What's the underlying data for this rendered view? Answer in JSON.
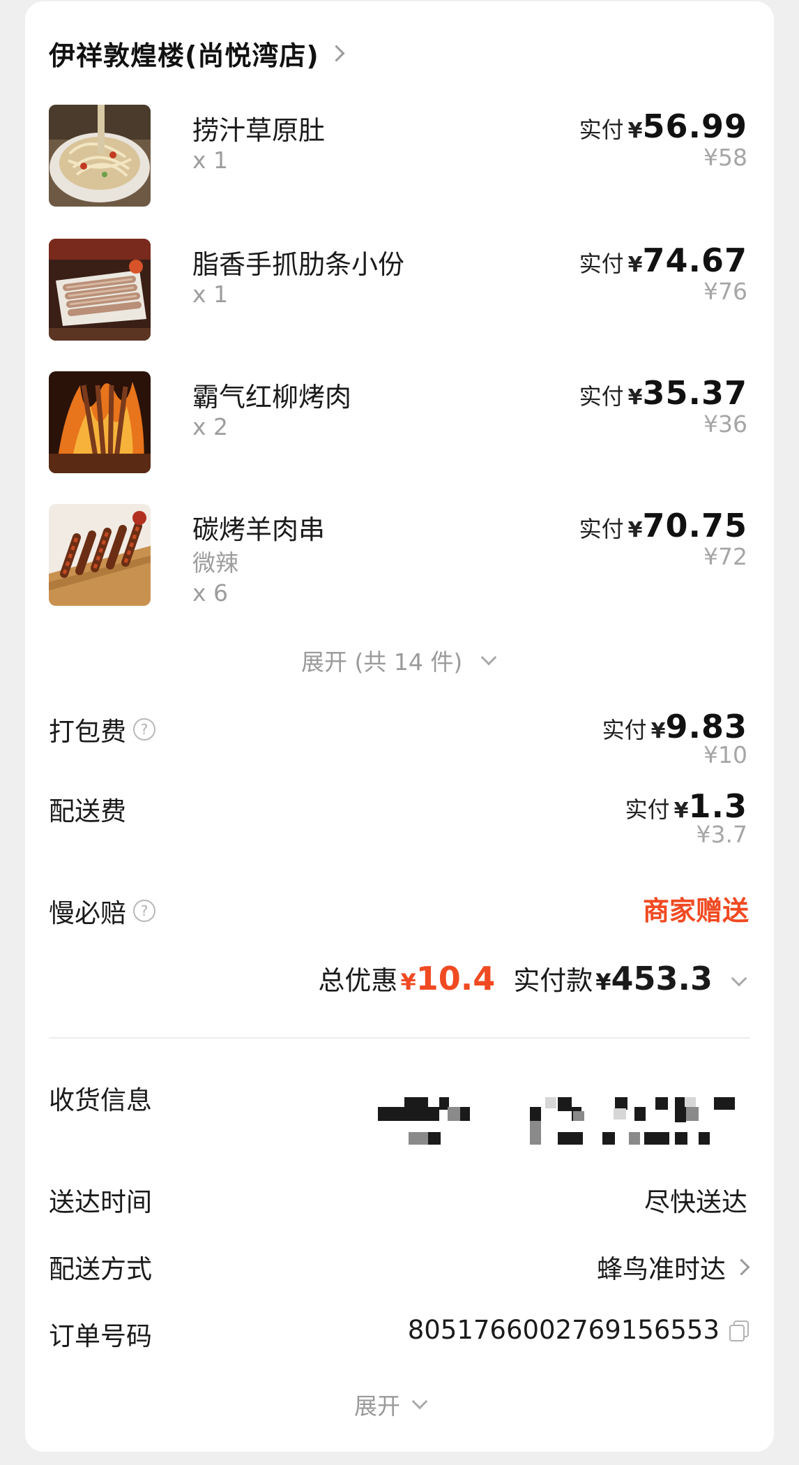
{
  "shop": {
    "name": "伊祥敦煌楼(尚悦湾店)"
  },
  "items": [
    {
      "name": "捞汁草原肚",
      "spec": "",
      "qty": "x 1",
      "paid_label": "实付",
      "currency": "¥",
      "paid": "56.99",
      "original": "¥58",
      "image": "noodle-salad-dish"
    },
    {
      "name": "脂香手抓肋条小份",
      "spec": "",
      "qty": "x 1",
      "paid_label": "实付",
      "currency": "¥",
      "paid": "74.67",
      "original": "¥76",
      "image": "sliced-lamb-platter"
    },
    {
      "name": "霸气红柳烤肉",
      "spec": "",
      "qty": "x 2",
      "paid_label": "实付",
      "currency": "¥",
      "paid": "35.37",
      "original": "¥36",
      "image": "flaming-skewers"
    },
    {
      "name": "碳烤羊肉串",
      "spec": "微辣",
      "qty": "x 6",
      "paid_label": "实付",
      "currency": "¥",
      "paid": "70.75",
      "original": "¥72",
      "image": "lamb-skewers-board"
    }
  ],
  "expand_items": "展开 (共 14 件)",
  "fees": {
    "packing": {
      "label": "打包费",
      "paid_label": "实付",
      "currency": "¥",
      "paid": "9.83",
      "original": "¥10"
    },
    "delivery": {
      "label": "配送费",
      "paid_label": "实付",
      "currency": "¥",
      "paid": "1.3",
      "original": "¥3.7"
    },
    "late_comp": {
      "label": "慢必赔",
      "value": "商家赠送"
    }
  },
  "summary": {
    "discount_label": "总优惠",
    "currency": "¥",
    "discount": "10.4",
    "paid_label": "实付款",
    "paid": "453.3"
  },
  "info": {
    "address_label": "收货信息",
    "time_label": "送达时间",
    "time_value": "尽快送达",
    "method_label": "配送方式",
    "method_value": "蜂鸟准时达",
    "order_label": "订单号码",
    "order_value": "8051766002769156553"
  },
  "expand_more": "展开",
  "colors": {
    "accent": "#f04a22",
    "text": "#1a1a1a",
    "muted": "#9d9d9d",
    "card": "#ffffff",
    "background": "#efefef"
  }
}
